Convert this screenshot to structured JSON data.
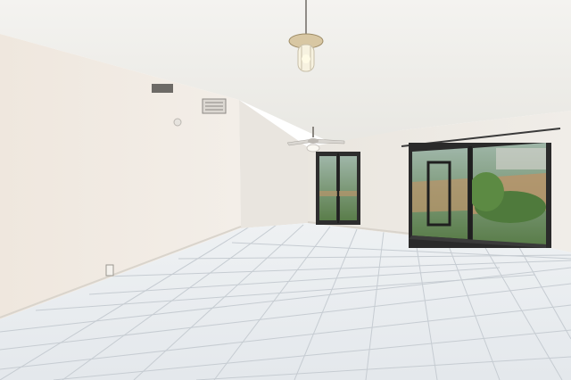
{
  "scene": {
    "description_name": "empty-room-photo",
    "palette": {
      "ceiling": "#f1f0ec",
      "wall_left": "#efe9e1",
      "wall_back": "#ece8e2",
      "floor_light": "#e9edf0",
      "floor_grout": "#c9ced3",
      "door_frame": "#2b2b2b",
      "foliage": "#4f7a3c",
      "fence": "#b8946a"
    },
    "fixtures": [
      "pendant-light",
      "ceiling-fan",
      "hvac-vent",
      "hvac-vent-small",
      "electrical-outlet",
      "curtain-rod"
    ]
  }
}
